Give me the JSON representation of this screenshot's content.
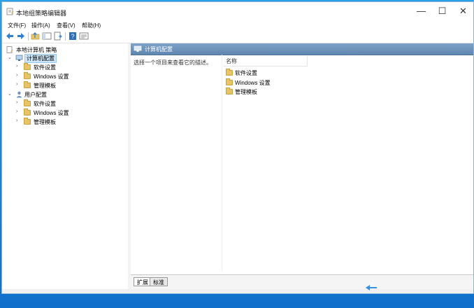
{
  "window": {
    "title": "本地组策略编辑器",
    "minimize_glyph": "—",
    "maximize_glyph": "☐",
    "close_glyph": "✕"
  },
  "menu": [
    {
      "label": "文件(F)"
    },
    {
      "label": "操作(A)"
    },
    {
      "label": "查看(V)"
    },
    {
      "label": "帮助(H)"
    }
  ],
  "toolbar": {
    "icons": [
      "back-arrow-icon",
      "forward-arrow-icon",
      "up-folder-icon",
      "show-hide-tree-icon",
      "export-list-icon",
      "help-icon",
      "properties-icon"
    ]
  },
  "tree": {
    "root": "本地计算机 策略",
    "computer_config": "计算机配置",
    "computer_children": [
      "软件设置",
      "Windows 设置",
      "管理模板"
    ],
    "user_config": "用户配置",
    "user_children": [
      "软件设置",
      "Windows 设置",
      "管理模板"
    ]
  },
  "content": {
    "header_title": "计算机配置",
    "description": "选择一个项目来查看它的描述。",
    "column_name": "名称",
    "items": [
      "软件设置",
      "Windows 设置",
      "管理模板"
    ]
  },
  "tabs": [
    {
      "label": "扩展"
    },
    {
      "label": "标准"
    }
  ],
  "colors": {
    "header_blue": "#6a90b8",
    "selection": "#cce4f7",
    "folder": "#e8c469",
    "desktop": "#1b87da"
  }
}
